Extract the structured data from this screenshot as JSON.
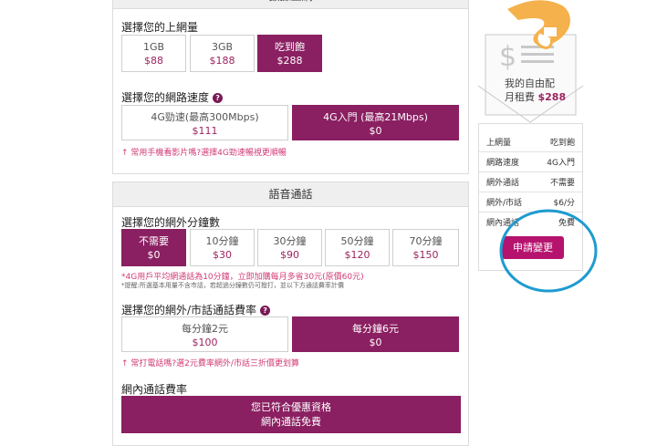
{
  "plan_data": {
    "header": "數據上網",
    "prompt": "選擇您的上網量",
    "options": [
      {
        "name": "1GB",
        "price": "$88",
        "selected": false
      },
      {
        "name": "3GB",
        "price": "$188",
        "selected": false
      },
      {
        "name": "吃到飽",
        "price": "$288",
        "selected": true
      }
    ]
  },
  "speed": {
    "prompt": "選擇您的網路速度",
    "options": [
      {
        "name": "4G勁速(最高300Mbps)",
        "price": "$111",
        "selected": false
      },
      {
        "name": "4G入門 (最高21Mbps)",
        "price": "$0",
        "selected": true
      }
    ],
    "note": "↑ 常用手機看影片嗎?選擇4G勁速暢視更順暢"
  },
  "voice": {
    "header": "語音通話",
    "minutes_prompt": "選擇您的網外分鐘數",
    "minutes": [
      {
        "name": "不需要",
        "price": "$0",
        "selected": true
      },
      {
        "name": "10分鐘",
        "price": "$30",
        "selected": false
      },
      {
        "name": "30分鐘",
        "price": "$90",
        "selected": false
      },
      {
        "name": "50分鐘",
        "price": "$120",
        "selected": false
      },
      {
        "name": "70分鐘",
        "price": "$150",
        "selected": false
      }
    ],
    "note1": "*4G用戶平均網通話為10分鐘，立即加購每月多省30元(原價60元)",
    "note2": "*提醒:所選基本用量不含市話，若超過分鐘數仍可撥打，並以下方通話費率計價",
    "rate_prompt": "選擇您的網外/市話通話費率",
    "rates": [
      {
        "name": "每分鐘2元",
        "price": "$100",
        "selected": false
      },
      {
        "name": "每分鐘6元",
        "price": "$0",
        "selected": true
      }
    ],
    "rate_note": "↑ 常打電話嗎?選2元費率網外/市話三折價更划算",
    "onnet_label": "網內通話費率",
    "onnet_line1": "您已符合優惠資格",
    "onnet_line2": "網內通話免費"
  },
  "summary": {
    "title_line1": "我的自由配",
    "title_line2": "月租費",
    "total": "$288",
    "rows": [
      {
        "k": "上網量",
        "v": "吃到飽"
      },
      {
        "k": "網路速度",
        "v": "4G入門"
      },
      {
        "k": "網外通話",
        "v": "不需要"
      },
      {
        "k": "網外/市話",
        "v": "$6/分"
      },
      {
        "k": "網內通話",
        "v": "免費"
      }
    ],
    "button": "申請變更"
  },
  "icons": {
    "help": "question-icon",
    "money": "dollar-bill-icon",
    "hand": "hand-icon",
    "highlight": "circle-annotation"
  },
  "colors": {
    "brand": "#8a1f61",
    "price": "#9c2460",
    "note": "#d13b74",
    "annotation": "#1e9bd0",
    "hand": "#f5b14c"
  }
}
